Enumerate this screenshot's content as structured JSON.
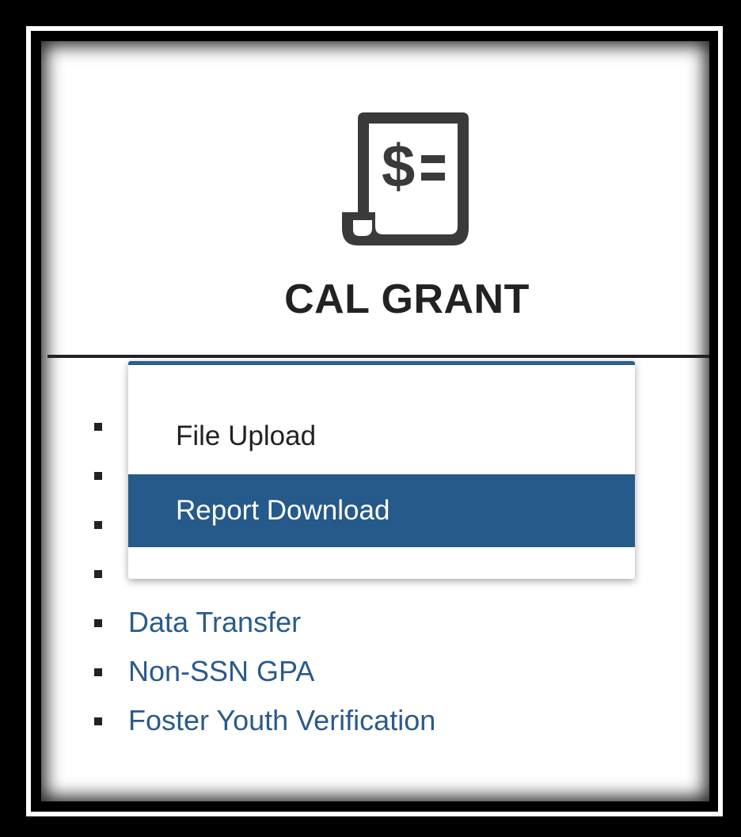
{
  "card": {
    "icon": "dollar-scroll-icon",
    "title": "CAL GRANT"
  },
  "menu_links": [
    {
      "label": ""
    },
    {
      "label": ""
    },
    {
      "label": ""
    },
    {
      "label": ""
    },
    {
      "label": "Data Transfer"
    },
    {
      "label": "Non-SSN GPA"
    },
    {
      "label": "Foster Youth Verification"
    }
  ],
  "dropdown": {
    "items": [
      {
        "label": "File Upload",
        "selected": false
      },
      {
        "label": "Report Download",
        "selected": true
      }
    ]
  },
  "colors": {
    "link": "#2a5a8c",
    "highlight": "#255a8a",
    "title": "#222222",
    "frame": "#000000"
  }
}
